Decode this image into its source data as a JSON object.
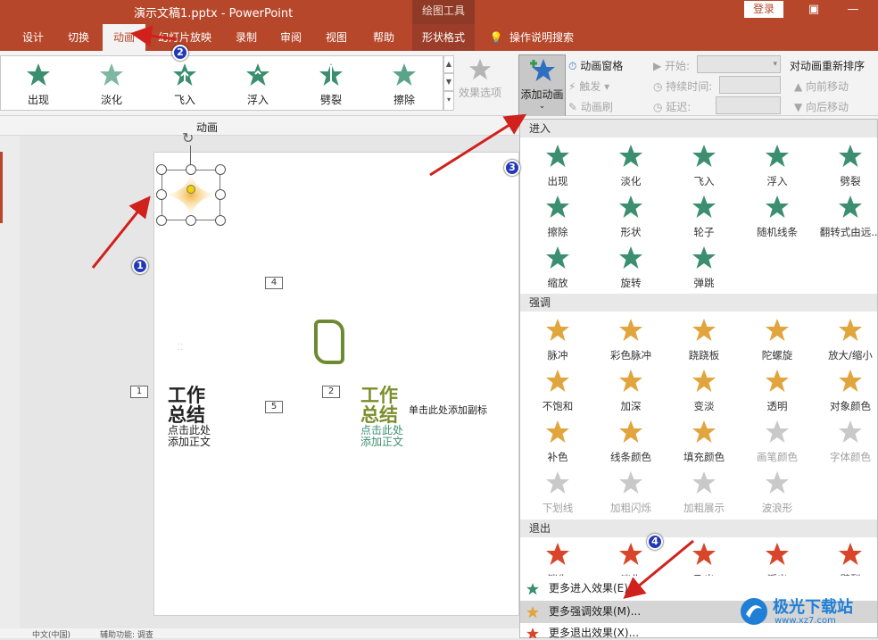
{
  "window": {
    "title": "演示文稿1.pptx  -  PowerPoint",
    "context_label": "绘图工具",
    "login": "登录"
  },
  "tabs": [
    "设计",
    "切换",
    "动画",
    "幻灯片放映",
    "录制",
    "审阅",
    "视图",
    "帮助",
    "形状格式"
  ],
  "tell_me": "操作说明搜索",
  "gallery": {
    "items": [
      "出现",
      "淡化",
      "飞入",
      "浮入",
      "劈裂",
      "擦除"
    ],
    "effect_options": "效果选项",
    "group_label": "动画"
  },
  "add_animation": "添加动画",
  "advanced": {
    "pane": "动画窗格",
    "trigger": "触发",
    "painter": "动画刷"
  },
  "timing": {
    "start": "开始:",
    "duration": "持续时间:",
    "delay": "延迟:"
  },
  "reorder": {
    "title": "对动画重新排序",
    "earlier": "向前移动",
    "later": "向后移动"
  },
  "slide": {
    "tags": [
      "4",
      "1",
      "2",
      "5"
    ],
    "title1": "工作\n总结",
    "sub1": "点击此处\n添加正文",
    "title2": "工作\n总结",
    "sub2": "点击此处\n添加正文",
    "subtitle": "单击此处添加副标"
  },
  "status": {
    "lang": "中文(中国)",
    "access": "辅助功能: 调查"
  },
  "menu": {
    "entrance_label": "进入",
    "entrance": [
      "出现",
      "淡化",
      "飞入",
      "浮入",
      "劈裂",
      "擦除",
      "形状",
      "轮子",
      "随机线条",
      "翻转式由远...",
      "缩放",
      "旋转",
      "弹跳"
    ],
    "emphasis_label": "强调",
    "emphasis": [
      "脉冲",
      "彩色脉冲",
      "跷跷板",
      "陀螺旋",
      "放大/缩小",
      "不饱和",
      "加深",
      "变淡",
      "透明",
      "对象颜色",
      "补色",
      "线条颜色",
      "填充颜色",
      "画笔颜色",
      "字体颜色",
      "下划线",
      "加粗闪烁",
      "加粗展示",
      "波浪形"
    ],
    "exit_label": "退出",
    "exit": [
      "消失",
      "淡化",
      "飞出",
      "浮出",
      "劈裂"
    ],
    "more_entrance": "更多进入效果(E)...",
    "more_emphasis": "更多强调效果(M)...",
    "more_exit": "更多退出效果(X)..."
  },
  "annotations": [
    "1",
    "2",
    "3",
    "4"
  ],
  "watermark": {
    "text": "极光下载站",
    "url": "www.xz7.com"
  },
  "colors": {
    "brand": "#b7472a",
    "entrance": "#3b8f70",
    "emphasis": "#e0a53c",
    "exit": "#d9452a",
    "arrow": "#d0211c"
  }
}
